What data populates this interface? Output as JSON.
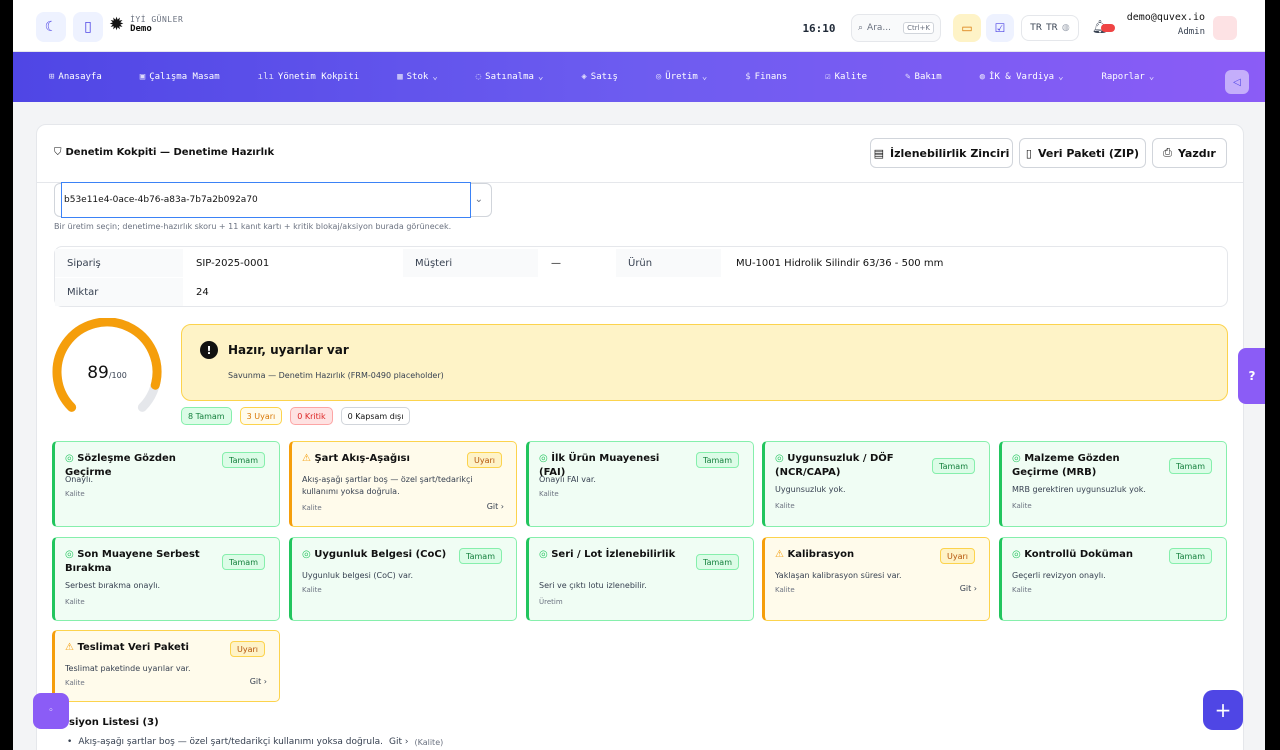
{
  "topbar": {
    "greeting_line1": "İYİ GÜNLER",
    "greeting_line2": "Demo",
    "time": "16:10",
    "search_placeholder": "Ara...",
    "search_shortcut": "Ctrl+K",
    "lang_label": "TR",
    "lang_value": "TR",
    "user_email": "demo@quvex.io",
    "user_role": "Admin"
  },
  "nav": [
    {
      "label": "Anasayfa",
      "icon": "⊞",
      "dropdown": false
    },
    {
      "label": "Çalışma Masam",
      "icon": "▣",
      "dropdown": false
    },
    {
      "label": "Yönetim Kokpiti",
      "icon": "ılı",
      "dropdown": false
    },
    {
      "label": "Stok",
      "icon": "▦",
      "dropdown": true
    },
    {
      "label": "Satınalma",
      "icon": "◌",
      "dropdown": true
    },
    {
      "label": "Satış",
      "icon": "◈",
      "dropdown": false
    },
    {
      "label": "Üretim",
      "icon": "◎",
      "dropdown": true
    },
    {
      "label": "Finans",
      "icon": "$",
      "dropdown": false
    },
    {
      "label": "Kalite",
      "icon": "☑",
      "dropdown": false
    },
    {
      "label": "Bakım",
      "icon": "✎",
      "dropdown": false
    },
    {
      "label": "İK & Vardiya",
      "icon": "◍",
      "dropdown": true
    },
    {
      "label": "Raporlar",
      "icon": "",
      "dropdown": true
    }
  ],
  "card": {
    "title": "Denetim Kokpiti — Denetime Hazırlık",
    "btn_trace": "İzlenebilirlik Zinciri",
    "btn_zip": "Veri Paketi (ZIP)",
    "btn_print": "Yazdır",
    "select_value": "b53e11e4-0ace-4b76-a83a-7b7a2b092a70",
    "select_help": "Bir üretim seçin; denetime-hazırlık skoru + 11 kanıt kartı + kritik blokaj/aksiyon burada görünecek."
  },
  "info": {
    "order_label": "Sipariş",
    "order_value": "SIP-2025-0001",
    "customer_label": "Müşteri",
    "customer_value": "—",
    "product_label": "Ürün",
    "product_value": "MU-1001 Hidrolik Silindir 63/36 - 500 mm",
    "qty_label": "Miktar",
    "qty_value": "24"
  },
  "score": {
    "value": "89",
    "max": "/100",
    "fraction": 0.89,
    "status_title": "Hazır, uyarılar var",
    "status_sub": "Savunma — Denetim Hazırlık (FRM-0490 placeholder)"
  },
  "chips": {
    "ok": "8 Tamam",
    "warn": "3 Uyarı",
    "crit": "0 Kritik",
    "out": "0 Kapsam dışı"
  },
  "evidence_cards": [
    {
      "title": "Sözleşme Gözden Geçirme",
      "badge": "Tamam",
      "status": "ok",
      "desc": "Onaylı.",
      "module": "Kalite",
      "go": ""
    },
    {
      "title": "Şart Akış-Aşağısı",
      "badge": "Uyarı",
      "status": "warn",
      "desc": "Akış-aşağı şartlar boş — özel şart/tedarikçi kullanımı yoksa doğrula.",
      "module": "Kalite",
      "go": "Git"
    },
    {
      "title": "İlk Ürün Muayenesi (FAI)",
      "badge": "Tamam",
      "status": "ok",
      "desc": "Onaylı FAI var.",
      "module": "Kalite",
      "go": ""
    },
    {
      "title": "Uygunsuzluk / DÖF (NCR/CAPA)",
      "badge": "Tamam",
      "status": "ok",
      "desc": "Uygunsuzluk yok.",
      "module": "Kalite",
      "go": ""
    },
    {
      "title": "Malzeme Gözden Geçirme (MRB)",
      "badge": "Tamam",
      "status": "ok",
      "desc": "MRB gerektiren uygunsuzluk yok.",
      "module": "Kalite",
      "go": ""
    },
    {
      "title": "Son Muayene Serbest Bırakma",
      "badge": "Tamam",
      "status": "ok",
      "desc": "Serbest bırakma onaylı.",
      "module": "Kalite",
      "go": ""
    },
    {
      "title": "Uygunluk Belgesi (CoC)",
      "badge": "Tamam",
      "status": "ok",
      "desc": "Uygunluk belgesi (CoC) var.",
      "module": "Kalite",
      "go": ""
    },
    {
      "title": "Seri / Lot İzlenebilirlik",
      "badge": "Tamam",
      "status": "ok",
      "desc": "Seri ve çıktı lotu izlenebilir.",
      "module": "Üretim",
      "go": ""
    },
    {
      "title": "Kalibrasyon",
      "badge": "Uyarı",
      "status": "warn",
      "desc": "Yaklaşan kalibrasyon süresi var.",
      "module": "Kalite",
      "go": "Git"
    },
    {
      "title": "Kontrollü Doküman",
      "badge": "Tamam",
      "status": "ok",
      "desc": "Geçerli revizyon onaylı.",
      "module": "Kalite",
      "go": ""
    },
    {
      "title": "Teslimat Veri Paketi",
      "badge": "Uyarı",
      "status": "warn",
      "desc": "Teslimat paketinde uyarılar var.",
      "module": "Kalite",
      "go": "Git"
    }
  ],
  "actions": {
    "title": "siyon Listesi (3)",
    "item1_text": "Akış-aşağı şartlar boş — özel şart/tedarikçi kullanımı yoksa doğrula.",
    "item1_go": "Git",
    "item1_module": "(Kalite)"
  },
  "colors": {
    "accent": "#4f46e5",
    "ok": "#22c55e",
    "warn": "#f59e0b",
    "critical": "#ef4444"
  }
}
